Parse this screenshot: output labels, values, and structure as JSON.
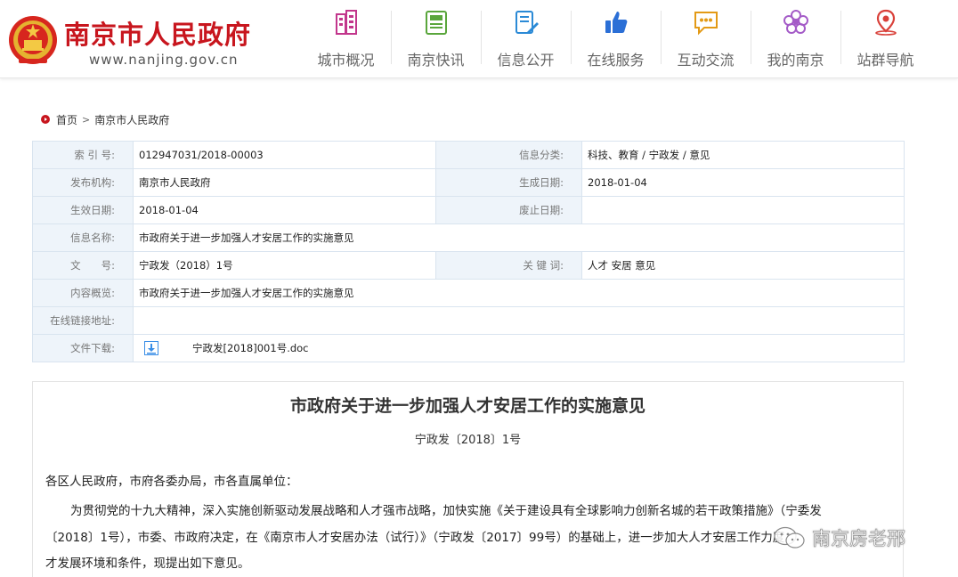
{
  "header": {
    "site_title": "南京市人民政府",
    "site_url": "www.nanjing.gov.cn",
    "nav": [
      {
        "label": "城市概况",
        "icon": "buildings-icon",
        "color": "#c2368c"
      },
      {
        "label": "南京快讯",
        "icon": "newspaper-icon",
        "color": "#5aa63c"
      },
      {
        "label": "信息公开",
        "icon": "document-edit-icon",
        "color": "#2b8ad6"
      },
      {
        "label": "在线服务",
        "icon": "thumbs-up-icon",
        "color": "#2b6fd6"
      },
      {
        "label": "互动交流",
        "icon": "chat-bubble-icon",
        "color": "#e39a16"
      },
      {
        "label": "我的南京",
        "icon": "plum-blossom-icon",
        "color": "#a45bc7"
      },
      {
        "label": "站群导航",
        "icon": "map-pin-icon",
        "color": "#d9413a"
      }
    ]
  },
  "breadcrumb": {
    "home": "首页",
    "separator": ">",
    "current": "南京市人民政府"
  },
  "info": {
    "index_label": "索 引 号:",
    "index_value": "012947031/2018-00003",
    "category_label": "信息分类:",
    "category_value": "科技、教育 / 宁政发 / 意见",
    "publisher_label": "发布机构:",
    "publisher_value": "南京市人民政府",
    "created_label": "生成日期:",
    "created_value": "2018-01-04",
    "effective_label": "生效日期:",
    "effective_value": "2018-01-04",
    "expiry_label": "废止日期:",
    "expiry_value": "",
    "name_label": "信息名称:",
    "name_value": "市政府关于进一步加强人才安居工作的实施意见",
    "docno_label": "文　　号:",
    "docno_value": "宁政发（2018）1号",
    "keywords_label": "关 键 词:",
    "keywords_value": "人才 安居 意见",
    "summary_label": "内容概览:",
    "summary_value": "市政府关于进一步加强人才安居工作的实施意见",
    "link_label": "在线链接地址:",
    "link_value": "",
    "download_label": "文件下载:",
    "download_value": "宁政发[2018]001号.doc"
  },
  "article": {
    "title": "市政府关于进一步加强人才安居工作的实施意见",
    "doc_number": "宁政发〔2018〕1号",
    "salutation": "各区人民政府，市府各委办局，市各直属单位：",
    "para1_line1": "为贯彻党的十九大精神，深入实施创新驱动发展战略和人才强市战略，加快实施《关于建设具有全球影响力创新名城的若干政策措施》（宁委发",
    "para1_line2": "〔2018〕1号），市委、市政府决定，在《南京市人才安居办法（试行）》（宁政发〔2017〕99号）的基础上，进一步加大人才安居工作力度，",
    "para1_line3": "才发展环境和条件，现提出如下意见。"
  },
  "watermark": {
    "text": "南京房老邢"
  }
}
